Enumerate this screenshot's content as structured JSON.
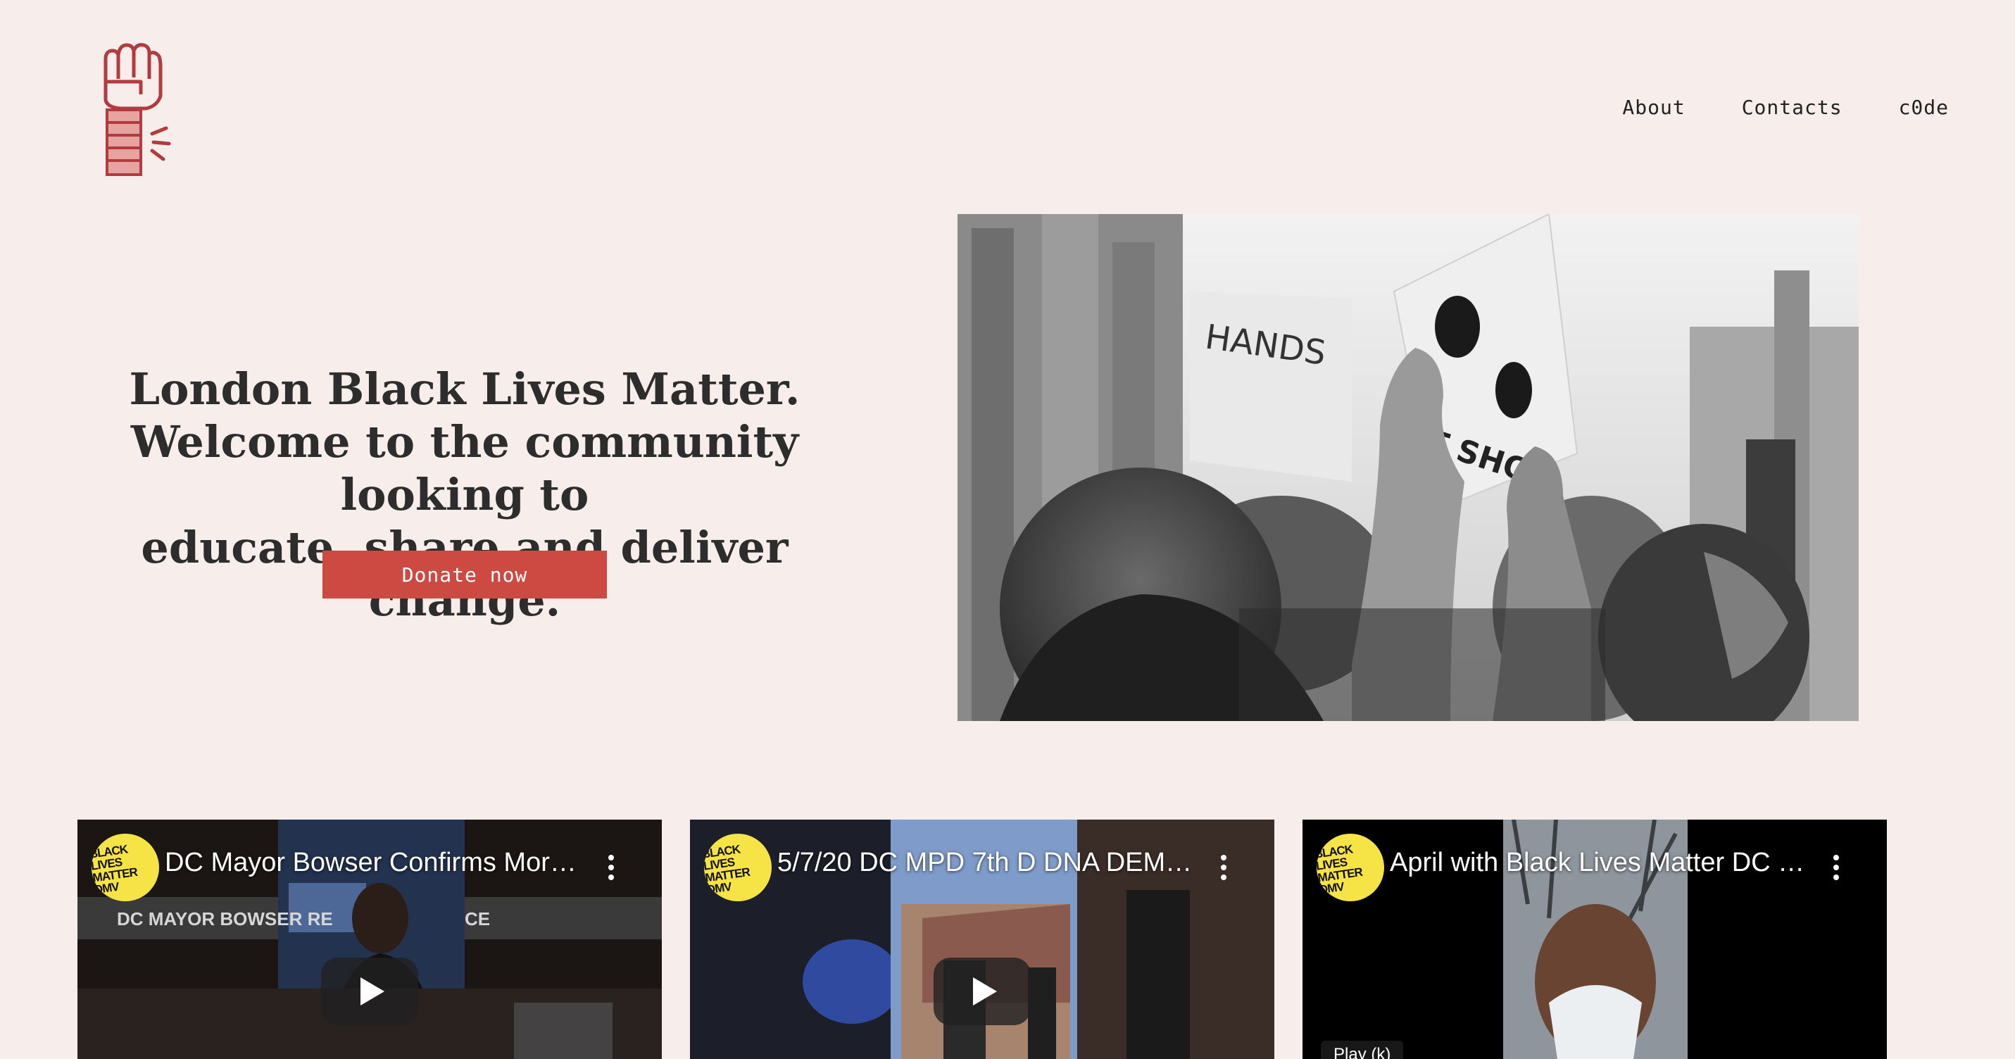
{
  "nav": {
    "about": "About",
    "contacts": "Contacts",
    "code": "c0de"
  },
  "hero": {
    "heading_line1": "London Black Lives Matter.",
    "heading_line2": "Welcome to the community looking to",
    "heading_line3": "educate, share and deliver change.",
    "donate_label": "Donate now",
    "photo_sign_text": "HANDS UP DON'T SHOOT"
  },
  "videos": [
    {
      "title": "DC Mayor Bowser Confirms More …",
      "channel_logo": "BLACK LIVES MATTER DMV",
      "overlay_text": "DC MAYOR BOWSER RE",
      "overlay_text2": "CE"
    },
    {
      "title": "5/7/20 DC MPD 7th D DNA DEMA…",
      "channel_logo": "BLACK LIVES MATTER DMV"
    },
    {
      "title": "April with Black Lives Matter DC at …",
      "channel_logo": "BLACK LIVES MATTER DMV",
      "play_hint": "Play (k)"
    }
  ],
  "colors": {
    "background": "#f7eeec",
    "accent": "#cd4a42",
    "logo": "#b23b3f"
  }
}
